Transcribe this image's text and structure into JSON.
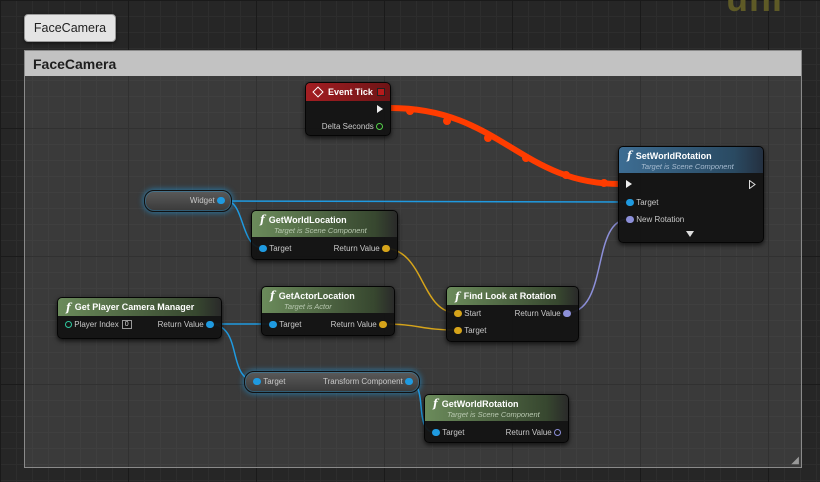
{
  "tab": {
    "label": "FaceCamera"
  },
  "comment": {
    "title": "FaceCamera"
  },
  "colors": {
    "exec_wire": "#ff3c00",
    "object_pin": "#1f9ae0",
    "vector_pin": "#d6a41a",
    "rotator_pin": "#8c8fd8",
    "float_pin": "#55d04a",
    "event_header": "#a31e22",
    "function_header": "#6b8b5b",
    "target_function_header": "#3d6d93"
  },
  "nodes": {
    "event_tick": {
      "title": "Event Tick",
      "icon": "event-diamond-icon",
      "out_delta": "Delta Seconds"
    },
    "set_world_rotation": {
      "title": "SetWorldRotation",
      "subtitle": "Target is Scene Component",
      "in_target": "Target",
      "in_new_rotation": "New Rotation"
    },
    "widget_var": {
      "label": "Widget"
    },
    "get_world_location": {
      "title": "GetWorldLocation",
      "subtitle": "Target is Scene Component",
      "in_target": "Target",
      "out_return": "Return Value"
    },
    "get_player_camera_manager": {
      "title": "Get Player Camera Manager",
      "in_player_index": "Player Index",
      "player_index_value": "0",
      "out_return": "Return Value"
    },
    "get_actor_location": {
      "title": "GetActorLocation",
      "subtitle": "Target is Actor",
      "in_target": "Target",
      "out_return": "Return Value"
    },
    "find_look_at_rotation": {
      "title": "Find Look at Rotation",
      "in_start": "Start",
      "in_target": "Target",
      "out_return": "Return Value"
    },
    "transform_component": {
      "in_target": "Target",
      "out_label": "Transform Component"
    },
    "get_world_rotation": {
      "title": "GetWorldRotation",
      "subtitle": "Target is Scene Component",
      "in_target": "Target",
      "out_return": "Return Value"
    }
  }
}
